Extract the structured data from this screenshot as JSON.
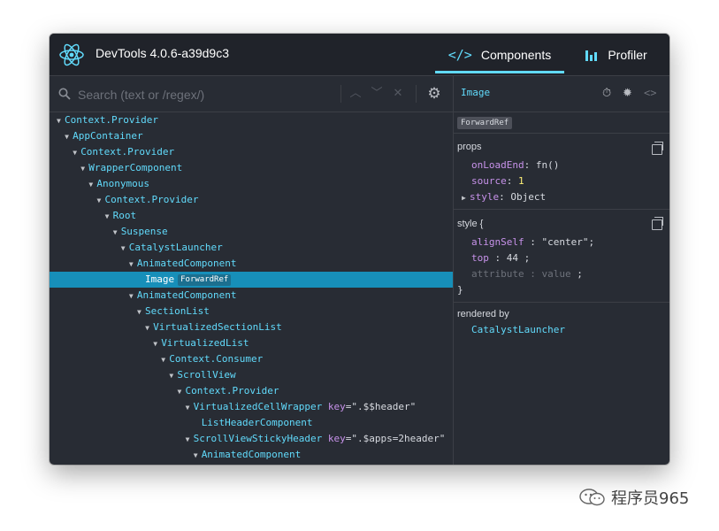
{
  "app": {
    "title": "DevTools 4.0.6-a39d9c3"
  },
  "tabs": [
    {
      "label": "Components",
      "icon": "code-brackets-icon",
      "active": true
    },
    {
      "label": "Profiler",
      "icon": "bar-chart-icon",
      "active": false
    }
  ],
  "search": {
    "placeholder": "Search (text or /regex/)",
    "value": ""
  },
  "tree": [
    {
      "name": "Context.Provider",
      "depth": 0,
      "expanded": true
    },
    {
      "name": "AppContainer",
      "depth": 1,
      "expanded": true
    },
    {
      "name": "Context.Provider",
      "depth": 2,
      "expanded": true
    },
    {
      "name": "WrapperComponent",
      "depth": 3,
      "expanded": true
    },
    {
      "name": "Anonymous",
      "depth": 4,
      "expanded": true
    },
    {
      "name": "Context.Provider",
      "depth": 5,
      "expanded": true
    },
    {
      "name": "Root",
      "depth": 6,
      "expanded": true
    },
    {
      "name": "Suspense",
      "depth": 7,
      "expanded": true
    },
    {
      "name": "CatalystLauncher",
      "depth": 8,
      "expanded": true
    },
    {
      "name": "AnimatedComponent",
      "depth": 9,
      "expanded": true
    },
    {
      "name": "Image",
      "depth": 10,
      "expanded": false,
      "selected": true,
      "badge": "ForwardRef"
    },
    {
      "name": "AnimatedComponent",
      "depth": 9,
      "expanded": true
    },
    {
      "name": "SectionList",
      "depth": 10,
      "expanded": true
    },
    {
      "name": "VirtualizedSectionList",
      "depth": 11,
      "expanded": true
    },
    {
      "name": "VirtualizedList",
      "depth": 12,
      "expanded": true
    },
    {
      "name": "Context.Consumer",
      "depth": 13,
      "expanded": true
    },
    {
      "name": "ScrollView",
      "depth": 14,
      "expanded": true
    },
    {
      "name": "Context.Provider",
      "depth": 15,
      "expanded": true
    },
    {
      "name": "VirtualizedCellWrapper",
      "depth": 16,
      "expanded": true,
      "key_label": "key",
      "key_value": "=\".$$header\""
    },
    {
      "name": "ListHeaderComponent",
      "depth": 17,
      "expanded": false
    },
    {
      "name": "ScrollViewStickyHeader",
      "depth": 16,
      "expanded": true,
      "key_label": "key",
      "key_value": "=\".$apps=2header\""
    },
    {
      "name": "AnimatedComponent",
      "depth": 17,
      "expanded": true
    }
  ],
  "inspector": {
    "selected_name": "Image",
    "badge": "ForwardRef",
    "props_title": "props",
    "props": [
      {
        "key": "onLoadEnd",
        "value": "fn()",
        "kind": "fn"
      },
      {
        "key": "source",
        "value": "1",
        "kind": "num"
      },
      {
        "key": "style",
        "value": "Object",
        "kind": "obj"
      }
    ],
    "style_title": "style {",
    "style_props": [
      {
        "key": "alignSelf",
        "value": "\"center\"",
        "dim": false
      },
      {
        "key": "top",
        "value": "44",
        "dim": false
      },
      {
        "key": "attribute",
        "value": "value",
        "dim": true
      }
    ],
    "style_close": "}",
    "rendered_by_title": "rendered by",
    "rendered_by": "CatalystLauncher"
  },
  "watermark": {
    "text": "程序员965"
  },
  "colors": {
    "accent": "#61dafb",
    "selection": "#178fb9",
    "background": "#282c34",
    "keyword": "#c792ea",
    "number": "#fff176"
  }
}
